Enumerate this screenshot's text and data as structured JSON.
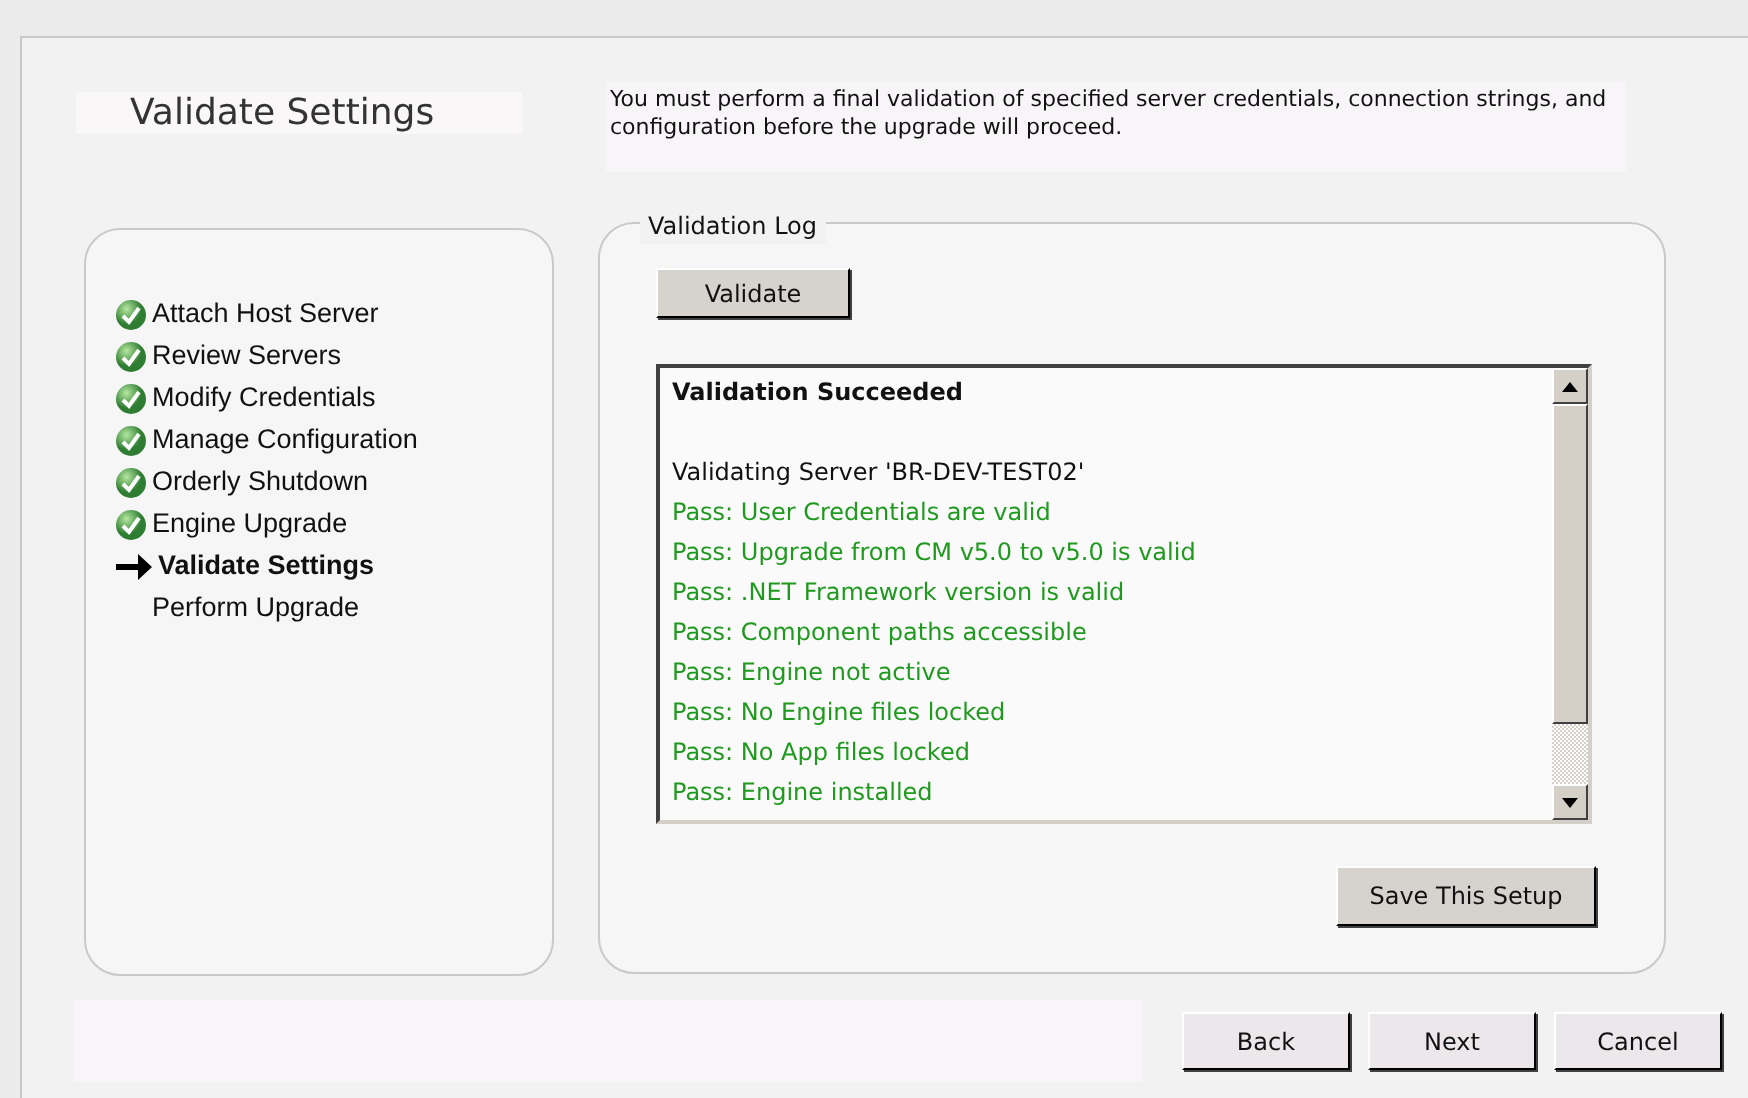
{
  "header": {
    "title": "Validate Settings",
    "description": "You must perform a final validation of specified server credentials, connection strings, and configuration before the upgrade will proceed."
  },
  "steps": [
    {
      "label": "Attach Host Server",
      "completed": true,
      "selected": false
    },
    {
      "label": "Review Servers",
      "completed": true,
      "selected": false
    },
    {
      "label": "Modify Credentials",
      "completed": true,
      "selected": false
    },
    {
      "label": "Manage Configuration",
      "completed": true,
      "selected": false
    },
    {
      "label": "Orderly Shutdown",
      "completed": true,
      "selected": false
    },
    {
      "label": "Engine Upgrade",
      "completed": true,
      "selected": false
    },
    {
      "label": "Validate Settings",
      "completed": false,
      "selected": true
    },
    {
      "label": "Perform Upgrade",
      "completed": false,
      "selected": false
    }
  ],
  "validation_log": {
    "legend": "Validation Log",
    "validate_button": "Validate",
    "lines": [
      {
        "kind": "heading",
        "text": "Validation Succeeded"
      },
      {
        "kind": "info",
        "text": "Validating Server 'BR-DEV-TEST02'"
      },
      {
        "kind": "pass",
        "text": "Pass: User Credentials are valid"
      },
      {
        "kind": "pass",
        "text": "Pass: Upgrade from CM v5.0 to v5.0 is valid"
      },
      {
        "kind": "pass",
        "text": "Pass: .NET Framework version is valid"
      },
      {
        "kind": "pass",
        "text": "Pass: Component paths accessible"
      },
      {
        "kind": "pass",
        "text": "Pass: Engine not active"
      },
      {
        "kind": "pass",
        "text": "Pass: No Engine files locked"
      },
      {
        "kind": "pass",
        "text": "Pass: No App files locked"
      },
      {
        "kind": "pass",
        "text": "Pass: Engine installed"
      }
    ],
    "save_button": "Save This Setup"
  },
  "footer": {
    "buttons": [
      "Back",
      "Next",
      "Cancel"
    ]
  }
}
